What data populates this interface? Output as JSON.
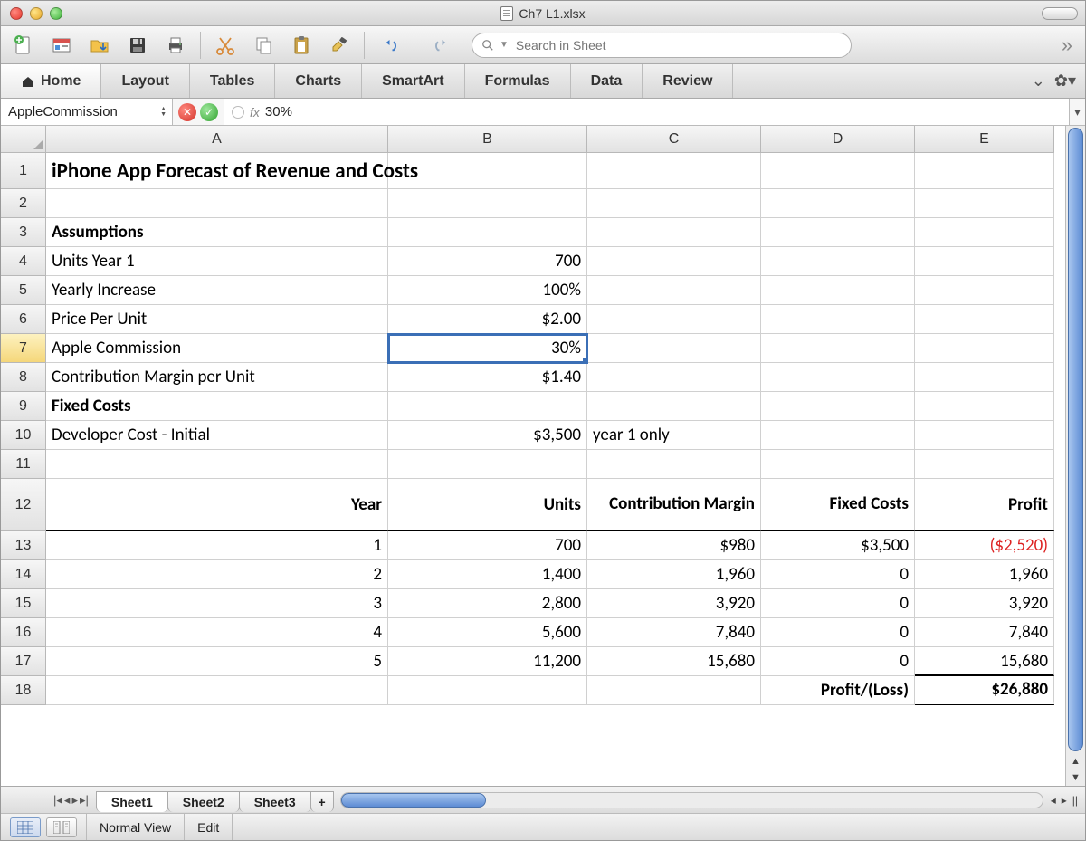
{
  "window": {
    "filename": "Ch7 L1.xlsx"
  },
  "toolbar": {
    "search_placeholder": "Search in Sheet"
  },
  "ribbon": {
    "tabs": [
      "Home",
      "Layout",
      "Tables",
      "Charts",
      "SmartArt",
      "Formulas",
      "Data",
      "Review"
    ],
    "active": 0
  },
  "formula_bar": {
    "name_box": "AppleCommission",
    "fx_label": "fx",
    "value": "30%"
  },
  "columns": [
    "A",
    "B",
    "C",
    "D",
    "E"
  ],
  "selected_cell": {
    "row": 7,
    "col": "B"
  },
  "rows": [
    {
      "n": 1,
      "A": "iPhone App Forecast of Revenue and Costs",
      "A_bold": true
    },
    {
      "n": 2
    },
    {
      "n": 3,
      "A": "Assumptions",
      "A_bold": true
    },
    {
      "n": 4,
      "A": "Units Year 1",
      "B": "700",
      "B_align": "r"
    },
    {
      "n": 5,
      "A": "Yearly Increase",
      "B": "100%",
      "B_align": "r"
    },
    {
      "n": 6,
      "A": "Price Per Unit",
      "B": "$2.00",
      "B_align": "r"
    },
    {
      "n": 7,
      "A": "Apple Commission",
      "B": "30%",
      "B_align": "r"
    },
    {
      "n": 8,
      "A": "Contribution Margin per Unit",
      "B": "$1.40",
      "B_align": "r"
    },
    {
      "n": 9,
      "A": "Fixed  Costs",
      "A_bold": true
    },
    {
      "n": 10,
      "A": "Developer Cost - Initial",
      "B": "$3,500",
      "B_align": "r",
      "C": "year 1 only"
    },
    {
      "n": 11
    },
    {
      "n": 12,
      "A": "Year",
      "A_align": "r",
      "A_bold": true,
      "B": "Units",
      "B_align": "r",
      "B_bold": true,
      "C": "Contribution Margin",
      "C_align": "r",
      "C_bold": true,
      "C_wrap": true,
      "D": "Fixed Costs",
      "D_align": "r",
      "D_bold": true,
      "D_wrap": true,
      "E": "Profit",
      "E_align": "r",
      "E_bold": true,
      "header_row": true
    },
    {
      "n": 13,
      "A": "1",
      "A_align": "r",
      "B": "700",
      "B_align": "r",
      "C": "$980",
      "C_align": "r",
      "D": "$3,500",
      "D_align": "r",
      "E": "($2,520)",
      "E_align": "r",
      "E_neg": true
    },
    {
      "n": 14,
      "A": "2",
      "A_align": "r",
      "B": "1,400",
      "B_align": "r",
      "C": "1,960",
      "C_align": "r",
      "D": "0",
      "D_align": "r",
      "E": "1,960",
      "E_align": "r"
    },
    {
      "n": 15,
      "A": "3",
      "A_align": "r",
      "B": "2,800",
      "B_align": "r",
      "C": "3,920",
      "C_align": "r",
      "D": "0",
      "D_align": "r",
      "E": "3,920",
      "E_align": "r"
    },
    {
      "n": 16,
      "A": "4",
      "A_align": "r",
      "B": "5,600",
      "B_align": "r",
      "C": "7,840",
      "C_align": "r",
      "D": "0",
      "D_align": "r",
      "E": "7,840",
      "E_align": "r"
    },
    {
      "n": 17,
      "A": "5",
      "A_align": "r",
      "B": "11,200",
      "B_align": "r",
      "C": "15,680",
      "C_align": "r",
      "D": "0",
      "D_align": "r",
      "E": "15,680",
      "E_align": "r"
    },
    {
      "n": 18,
      "D": "Profit/(Loss)",
      "D_align": "r",
      "D_bold": true,
      "E": "$26,880",
      "E_align": "r",
      "E_bold": true
    }
  ],
  "sheet_tabs": {
    "tabs": [
      "Sheet1",
      "Sheet2",
      "Sheet3"
    ],
    "active": 0,
    "add": "+"
  },
  "status": {
    "view": "Normal View",
    "mode": "Edit"
  }
}
